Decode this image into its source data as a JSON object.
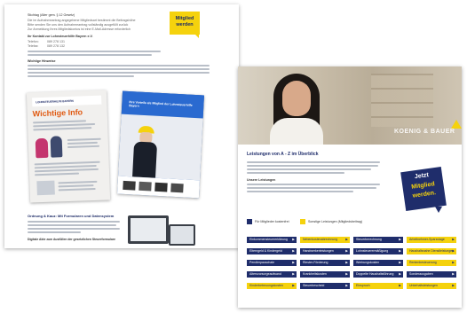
{
  "left_doc": {
    "header_lines": [
      "Stichtag (Alter gem. § 12 Gesetz)",
      "Die im Aufnahmeantrag angegebene Mitgliedsart bestimmt die Beitragshöhe",
      "Bitte senden Sie uns den Aufnahmeantrag vollständig ausgefüllt zurück",
      "Zur Anmeldung Ihres Mitgliedskontos ist eine E-Mail-Adresse erforderlich"
    ],
    "section_title": "Ihr Kontakt zur Lohnsteuerhilfe Bayern e.V.",
    "contact_rows": [
      {
        "label": "Telefon:",
        "value": "089 278 131"
      },
      {
        "label": "Telefax:",
        "value": "089 278 132"
      }
    ],
    "note_label": "Wichtige Hinweise",
    "badge": {
      "line1": "Mitglied",
      "line2": "werden"
    },
    "flyer_brand": "LOHNSTEUERHILFE BAYERN",
    "flyer_title": "Wichtige Info",
    "flyer2_heading": "Ihre Vorteile als Mitglied der Lohnsteuerhilfe Bayern",
    "flyer2_brand": "LOHNSTEUERHILFE BAYERN",
    "section2_title": "Ordnung & Kauz: Mit Formularen und Datensystem",
    "section2_sub": "Digitale Akte zum Ausfüllen der gesetzlichen Steuerformulare"
  },
  "right_doc": {
    "hero_brand": "KOENIG & BAUER",
    "heading": "Leistungen von A - Z im Überblick",
    "intro_label": "Unsere Leistungen",
    "badge": {
      "line1": "Jetzt",
      "line2": "Mitglied",
      "line3": "werden."
    },
    "legend": [
      {
        "label": "Für Mitglieder kostenfrei",
        "color": "#1f2d6b"
      },
      {
        "label": "Sonstige Leistungen (Mitgliedsbeitrag)",
        "color": "#f5d20d"
      }
    ],
    "buttons": [
      [
        "Einkommensteuererklärung",
        "Nebenkostenabrechnung",
        "Steuerberechnung",
        "Arbeitnehmer-Sparzulage"
      ],
      [
        "Elterngeld & Kindergeld",
        "Handwerkerleistungen",
        "Lohnsteuerermäßigung",
        "Haushaltsnahe Dienstleistungen"
      ],
      [
        "Pendlerpauschale",
        "Riester-Förderung",
        "Werbungskosten",
        "Rentenbesteuerung"
      ],
      [
        "Altersvorsorgeaufwand",
        "Krankheitskosten",
        "Doppelte Haushaltsführung",
        "Sonderausgaben"
      ],
      [
        "Kinderbetreuungskosten",
        "Steuerbescheid",
        "Einspruch",
        "Unterhaltsleistungen"
      ]
    ],
    "button_styles": [
      [
        "navy",
        "yellow",
        "navy",
        "yellow"
      ],
      [
        "navy",
        "navy",
        "navy",
        "yellow"
      ],
      [
        "navy",
        "navy",
        "navy",
        "yellow"
      ],
      [
        "navy",
        "navy",
        "navy",
        "navy"
      ],
      [
        "yellow",
        "navy",
        "yellow",
        "yellow"
      ]
    ]
  }
}
